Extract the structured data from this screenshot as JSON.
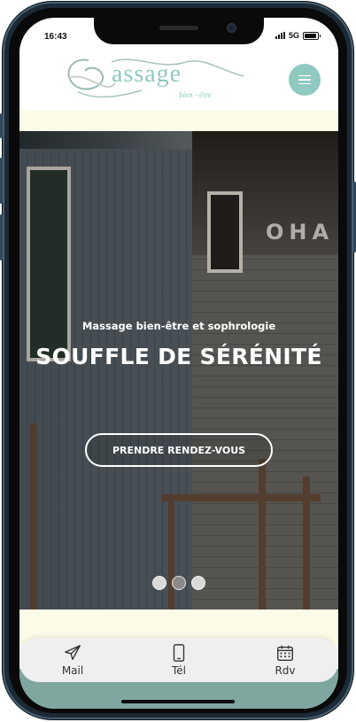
{
  "status_bar": {
    "time": "16:43",
    "network": "5G",
    "battery_level": 0.95
  },
  "header": {
    "logo_word": "assage",
    "logo_tagline": "bien - être",
    "menu_icon": "hamburger-icon",
    "brand_color": "#8fc9c1"
  },
  "hero": {
    "subtitle": "Massage bien-être et sophrologie",
    "title": "SOUFFLE DE SÉRÉNITÉ",
    "building_letters": "OHA",
    "cta_label": "PRENDRE RENDEZ-VOUS",
    "slides_count": 3,
    "active_slide": 2
  },
  "bottom_nav": {
    "items": [
      {
        "label": "Mail",
        "icon": "paper-plane-icon"
      },
      {
        "label": "Tél",
        "icon": "phone-icon"
      },
      {
        "label": "Rdv",
        "icon": "calendar-icon"
      }
    ]
  }
}
